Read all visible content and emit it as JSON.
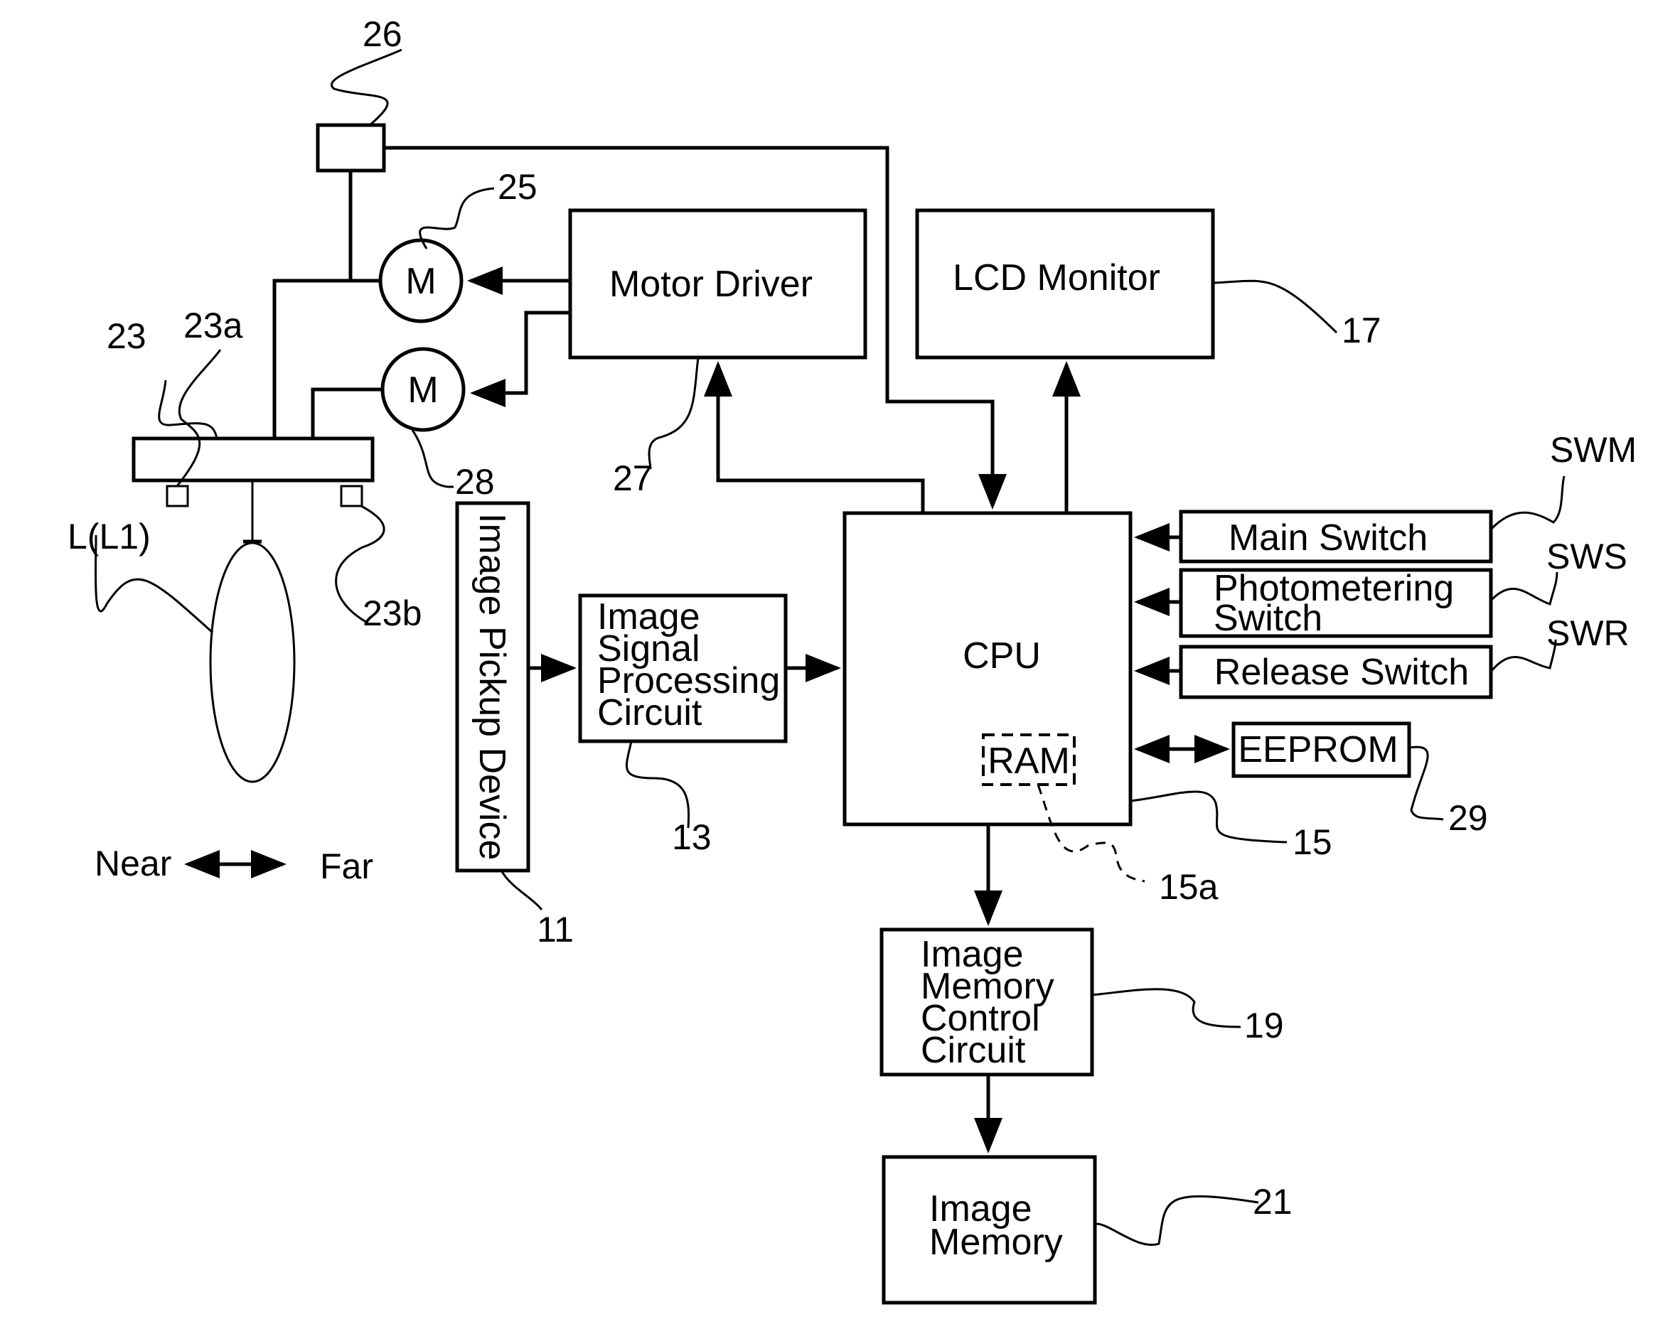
{
  "blocks": {
    "motor_driver": "Motor Driver",
    "lcd_monitor": "LCD Monitor",
    "cpu": "CPU",
    "ram": "RAM",
    "main_switch": "Main Switch",
    "photometering_switch": [
      "Photometering",
      "Switch"
    ],
    "release_switch": "Release Switch",
    "eeprom": "EEPROM",
    "image_pickup_device": "Image Pickup Device",
    "image_signal_processing": [
      "Image",
      "Signal",
      "Processing",
      "Circuit"
    ],
    "image_memory_control": [
      "Image",
      "Memory",
      "Control",
      "Circuit"
    ],
    "image_memory": [
      "Image",
      "Memory"
    ],
    "motor_symbol": "M"
  },
  "refs": {
    "r26": "26",
    "r25": "25",
    "r28": "28",
    "r27": "27",
    "r23": "23",
    "r23a": "23a",
    "r23b": "23b",
    "r17": "17",
    "r15": "15",
    "r15a": "15a",
    "r13": "13",
    "r11": "11",
    "r19": "19",
    "r21": "21",
    "r29": "29",
    "lens": "L(L1)",
    "swm": "SWM",
    "sws": "SWS",
    "swr": "SWR"
  },
  "direction": {
    "near": "Near",
    "far": "Far"
  }
}
